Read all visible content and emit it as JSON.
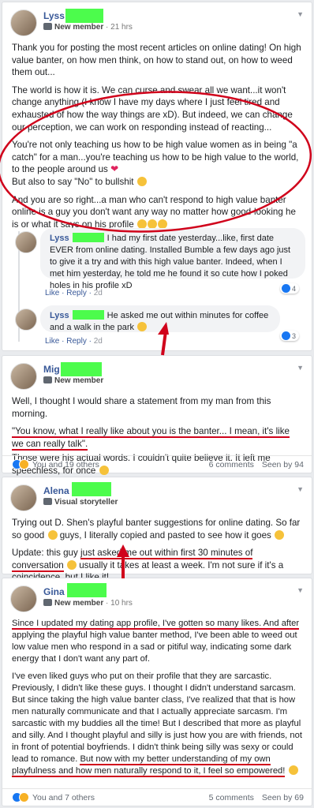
{
  "colors": {
    "annotation_red": "#d0021b",
    "redaction_green": "#4cfc4c",
    "link_blue": "#385898"
  },
  "post1": {
    "author": "Lyss",
    "role": "New member",
    "time": "21 hrs",
    "p1": "Thank you for posting the most recent articles on online dating! On high value banter, on how men think, on how to stand out, on how to weed them out...",
    "p2": "The world is how it is. We can curse and swear all we want...it won't change anything (I know I have my days where I just feel tired and exhausted of how the way things are xD). But indeed, we can change our perception, we can work on responding instead of reacting...",
    "p3": "You're not only teaching us how to be high value women as in being \"a catch\" for a man...you're teaching us how to be high value to the world, to the people around us",
    "p4": "But also to say \"No\" to bullshit",
    "p5": "And you are so right...a man who can't respond to high value banter online is a guy you don't want any way no matter how good-looking he is or what it says on his profile",
    "comments": [
      {
        "author": "Lyss",
        "text": "I had my first date yesterday...like, first date EVER from online dating. Installed Bumble a few days ago just to give it a try and with this high value banter. Indeed, when I met him yesterday, he told me he found it so cute how I poked holes in his profile xD",
        "like": "Like",
        "reply": "Reply",
        "time": "2d",
        "reactions": "4"
      },
      {
        "author": "Lyss",
        "text": "He asked me out within minutes for coffee and a walk in the park",
        "like": "Like",
        "reply": "Reply",
        "time": "2d",
        "reactions": "3"
      }
    ]
  },
  "post2": {
    "author": "Mig",
    "role": "New member",
    "p1": "Well, I thought I would share a statement from my man from this morning.",
    "p2": "\"You know, what I really like about you is the banter... I mean, it's like we can really talk\".",
    "p3": "Those were his actual words. I couldn't quite believe it. It left me speechless, for once",
    "reactions": "You and 19 others",
    "comments": "6 comments",
    "seen": "Seen by 94"
  },
  "post3": {
    "author": "Alena",
    "role": "Visual storyteller",
    "p1": "Trying out D. Shen's playful banter suggestions for online dating. So far so good",
    "p1b": "guys, I literally copied and pasted to see how it goes",
    "p2a": "Update: this guy ",
    "p2b": "just asked me out within first 30 minutes of conversation",
    "p2c": " usually it takes at least a week. I'm not sure if it's a coincidence, but I like it!"
  },
  "post4": {
    "author": "Gina",
    "role": "New member",
    "time": "10 hrs",
    "p1a": "Since I updated my dating app profile, I've gotten so many likes. And after",
    "p1b": " applying the playful high value banter method, I've been able to weed out low value men who respond in a sad or pitiful way, indicating some dark energy that I don't want any part of.",
    "p2a": "I've even liked guys who put on their profile that they are sarcastic. Previously, I didn't like these guys. I thought I didn't understand sarcasm. But since taking the high value banter class, I've realized that that is how men naturally communicate and that I actually appreciate sarcasm. I'm sarcastic with my buddies all the time! But I described that more as playful and silly. And I thought playful and silly is just how you are with friends, not in front of potential boyfriends. I didn't think being silly was sexy or could lead to romance. ",
    "p2b": "But now with my better understanding of my own playfulness and how men naturally respond to it, I feel so empowered!",
    "reactions": "You and 7 others",
    "comments": "5 comments",
    "seen": "Seen by 69"
  }
}
